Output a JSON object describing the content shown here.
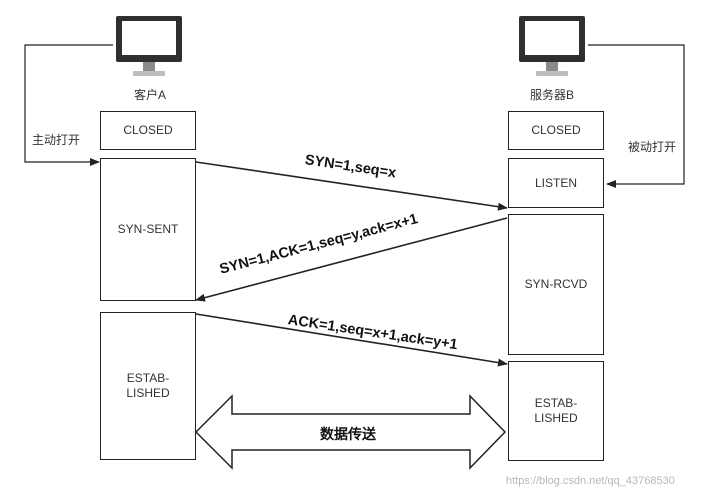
{
  "client": {
    "label": "客户A",
    "action": "主动打开",
    "states": [
      "CLOSED",
      "SYN-SENT",
      "ESTAB-\nLISHED"
    ]
  },
  "server": {
    "label": "服务器B",
    "action": "被动打开",
    "states": [
      "CLOSED",
      "LISTEN",
      "SYN-RCVD",
      "ESTAB-\nLISHED"
    ]
  },
  "messages": {
    "syn": "SYN=1,seq=x",
    "syn_ack": "SYN=1,ACK=1,seq=y,ack=x+1",
    "ack": "ACK=1,seq=x+1,ack=y+1"
  },
  "data_transfer": "数据传送",
  "watermark": "https://blog.csdn.net/qq_43768530",
  "icons": [
    "computer-icon",
    "computer-icon"
  ]
}
